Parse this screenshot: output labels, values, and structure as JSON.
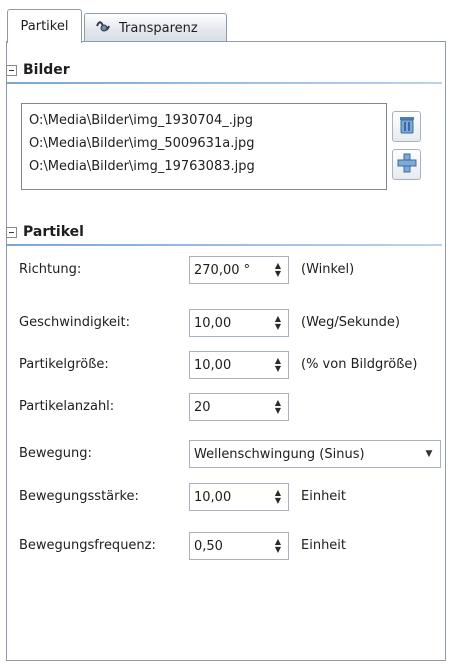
{
  "tabs": [
    {
      "label": "Partikel",
      "active": true
    },
    {
      "label": "Transparenz",
      "active": false,
      "icon": "transparency-icon"
    }
  ],
  "bilder": {
    "title": "Bilder",
    "files": [
      "O:\\Media\\Bilder\\img_1930704_.jpg",
      "O:\\Media\\Bilder\\img_5009631a.jpg",
      "O:\\Media\\Bilder\\img_19763083.jpg"
    ],
    "buttons": {
      "delete_icon": "trash-icon",
      "add_icon": "add-icon"
    }
  },
  "partikel": {
    "title": "Partikel",
    "richtung": {
      "label": "Richtung:",
      "value": "270,00 °",
      "unit": "(Winkel)"
    },
    "geschwindigkeit": {
      "label": "Geschwindigkeit:",
      "value": "10,00",
      "unit": "(Weg/Sekunde)"
    },
    "groesse": {
      "label": "Partikelgröße:",
      "value": "10,00",
      "unit": "(% von Bildgröße)"
    },
    "anzahl": {
      "label": "Partikelanzahl:",
      "value": "20"
    },
    "bewegung": {
      "label": "Bewegung:",
      "value": "Wellenschwingung (Sinus)"
    },
    "staerke": {
      "label": "Bewegungsstärke:",
      "value": "10,00",
      "unit": "Einheit"
    },
    "frequenz": {
      "label": "Bewegungsfrequenz:",
      "value": "0,50",
      "unit": "Einheit"
    }
  },
  "colors": {
    "accent_rule": "#7aa7d6",
    "border": "#8f9ba8"
  }
}
